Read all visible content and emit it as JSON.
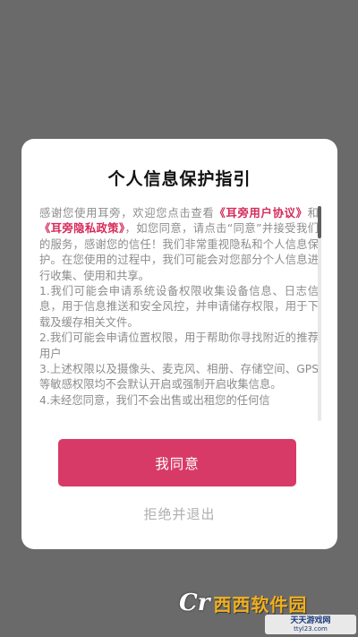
{
  "dialog": {
    "title": "个人信息保护指引",
    "content": {
      "p1_a": "感谢您使用耳旁，欢迎您点击查看",
      "user_agreement_link": "《耳旁用户协议》",
      "p1_b": "和",
      "privacy_policy_link": "《耳旁隐私政策》",
      "p1_c": "，如您同意，请点击“同意”并接受我们的服务，感谢您的信任！我们非常重视隐私和个人信息保护。在您使用的过程中，我们可能会对您部分个人信息进行收集、使用和共享。",
      "items": [
        "1.我们可能会申请系统设备权限收集设备信息、日志信息，用于信息推送和安全风控，并申请储存权限，用于下载及缓存相关文件。",
        "2.我们可能会申请位置权限，用于帮助你寻找附近的推荐用户",
        "3.上述权限以及摄像头、麦克风、相册、存储空间、GPS等敏感权限均不会默认开启或强制开启收集信息。",
        "4.未经您同意，我们不会出售或出租您的任何信"
      ]
    },
    "agree_button": "我同意",
    "reject_button": "拒绝并退出"
  },
  "watermark": {
    "logo_mark": "Cr",
    "logo_text": "西西软件园",
    "site_name": "天天游戏网",
    "site_url": "ttyl23.com"
  },
  "colors": {
    "overlay": "#6a6a6a",
    "accent": "#d83a67",
    "link": "#d52a5a",
    "body_text": "#8c8c8c"
  }
}
